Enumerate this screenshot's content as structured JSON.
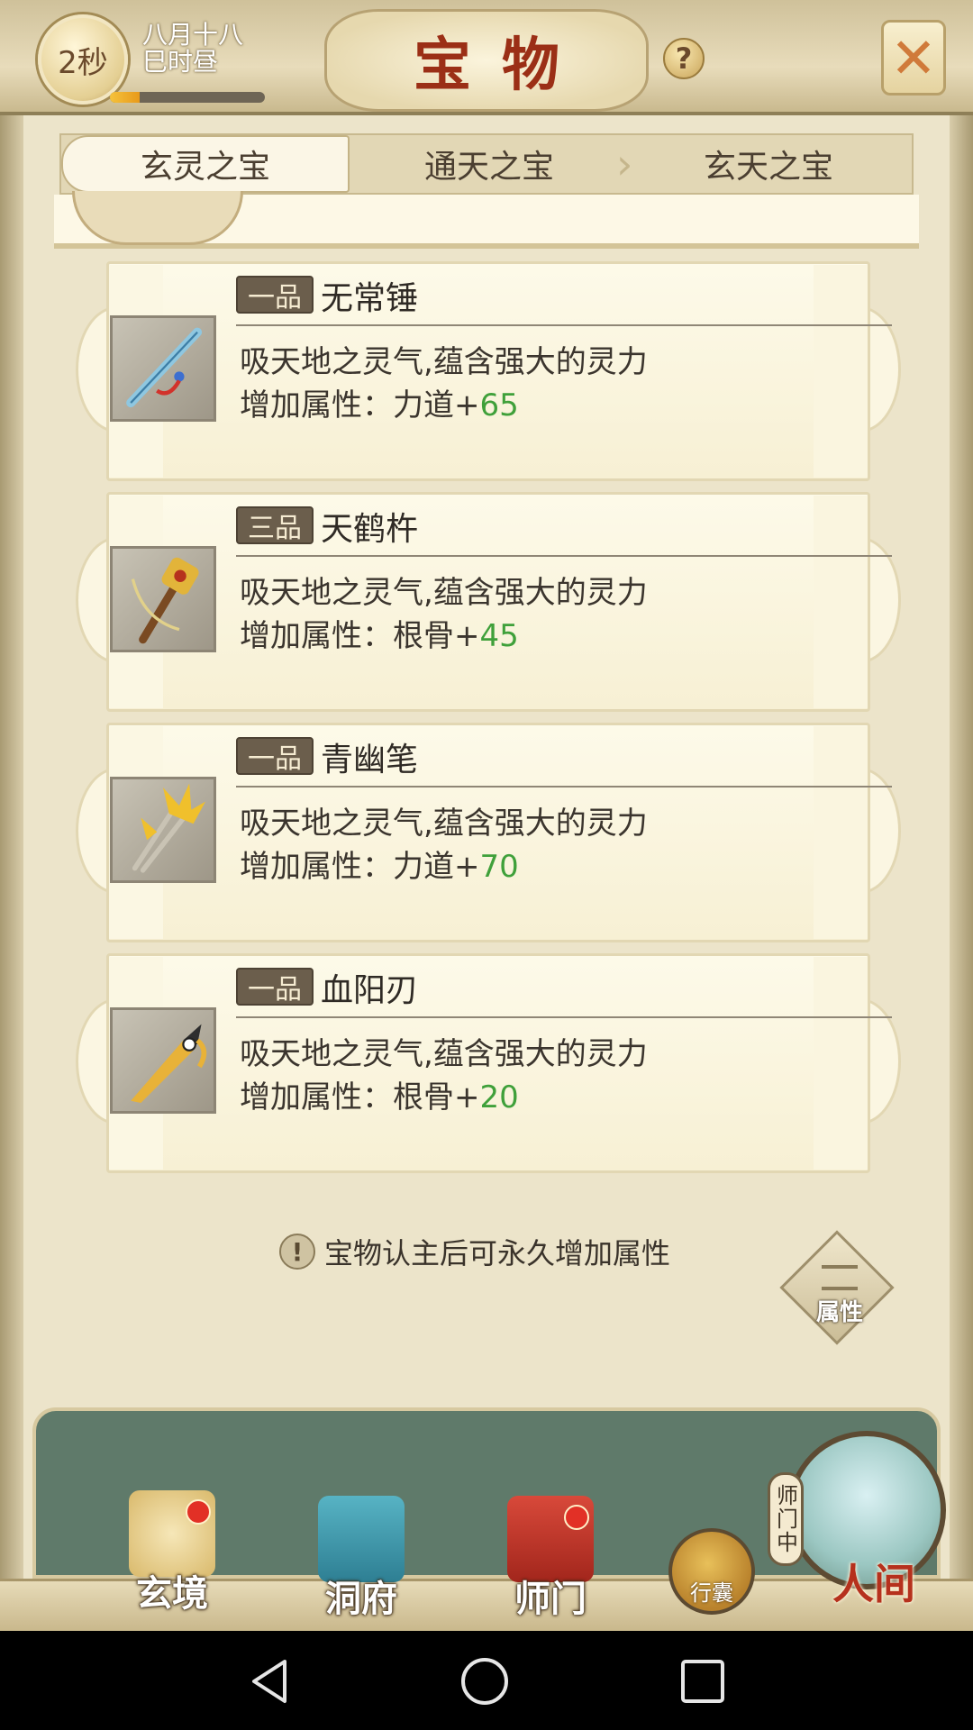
{
  "header": {
    "timer": "2秒",
    "date_line1": "八月十八",
    "date_line2": "巳时昼",
    "progress_fraction": 0.19,
    "title": "宝物",
    "help_symbol": "?",
    "close_icon": "close-x-icon"
  },
  "tabs": [
    {
      "label": "玄灵之宝",
      "active": true
    },
    {
      "label": "通天之宝",
      "active": false
    },
    {
      "label": "玄天之宝",
      "active": false
    }
  ],
  "items": [
    {
      "grade": "一品",
      "name": "无常锤",
      "desc": "吸天地之灵气,蕴含强大的灵力",
      "attr_label": "增加属性：力道+",
      "attr_value": "65",
      "icon": "flute-icon"
    },
    {
      "grade": "三品",
      "name": "天鹤杵",
      "desc": "吸天地之灵气,蕴含强大的灵力",
      "attr_label": "增加属性：根骨+",
      "attr_value": "45",
      "icon": "pestle-icon"
    },
    {
      "grade": "一品",
      "name": "青幽笔",
      "desc": "吸天地之灵气,蕴含强大的灵力",
      "attr_label": "增加属性：力道+",
      "attr_value": "70",
      "icon": "brush-icon"
    },
    {
      "grade": "一品",
      "name": "血阳刃",
      "desc": "吸天地之灵气,蕴含强大的灵力",
      "attr_label": "增加属性：根骨+",
      "attr_value": "20",
      "icon": "blade-icon"
    }
  ],
  "hint": {
    "icon": "!",
    "text": "宝物认主后可永久增加属性"
  },
  "attr_button": {
    "label": "属性"
  },
  "nav": {
    "xuanjing": "玄境",
    "dongfu": "洞府",
    "shimen": "师门",
    "bag": "行囊",
    "world": "人间",
    "sect_badge": "师门中"
  },
  "colors": {
    "accent_title": "#9b2f16",
    "attr_value": "#3fa03a",
    "badge": "#e23026"
  }
}
